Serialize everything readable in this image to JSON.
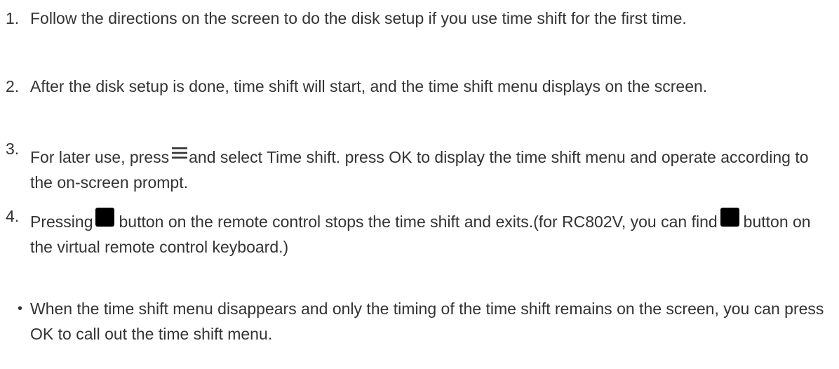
{
  "steps": [
    {
      "number": "1.",
      "text": "Follow the directions on the screen to do the disk setup if you use time shift for the first time."
    },
    {
      "number": "2.",
      "text": "After the disk setup is done, time shift will start, and the time shift menu displays on the screen."
    },
    {
      "number": "3.",
      "part1": "For later use, press",
      "icon": "menu-icon",
      "part2": "and select Time shift. press OK to display the time shift menu and operate according to the on-screen prompt."
    },
    {
      "number": "4.",
      "part1": "Pressing",
      "icon1": "stop-icon",
      "part2": "button on the remote control stops the time shift and exits.(for RC802V, you can find",
      "icon2": "stop-icon",
      "part3": "button on the virtual remote control keyboard.)"
    }
  ],
  "note": {
    "bullet": "•",
    "text": "When the time shift menu disappears and only the timing of the time shift remains on the screen, you can press OK to call out the time shift menu."
  }
}
